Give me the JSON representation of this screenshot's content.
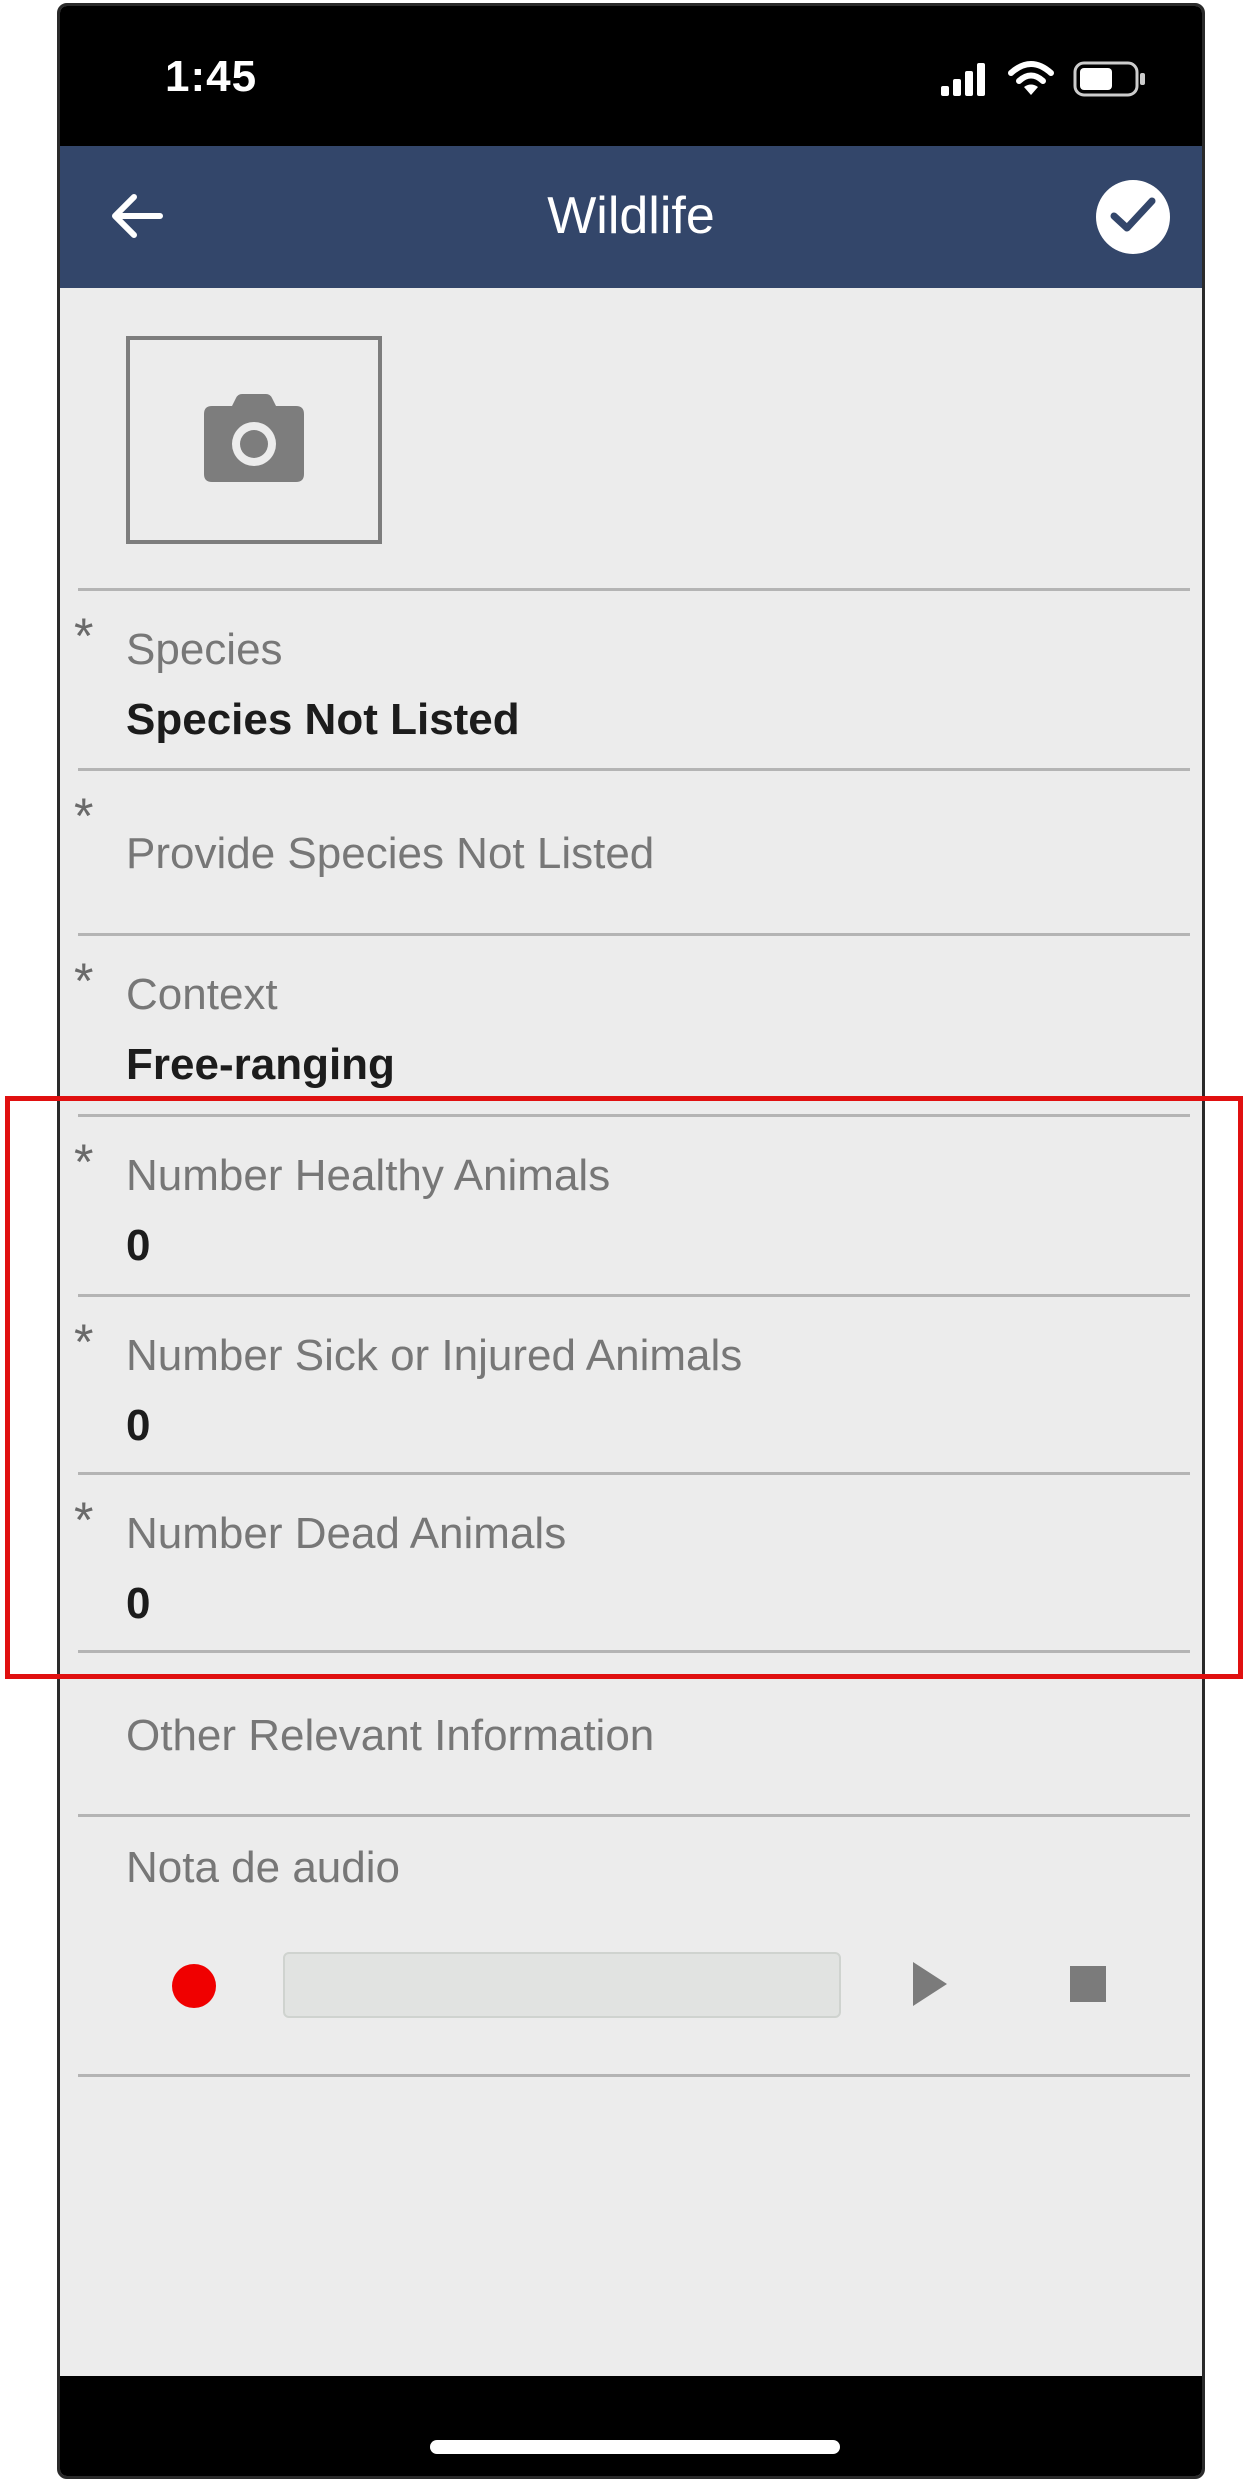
{
  "status_bar": {
    "time": "1:45"
  },
  "app_bar": {
    "title": "Wildlife",
    "back_icon": "arrow-left-icon",
    "confirm_icon": "check-circle-icon",
    "color": "#33466a"
  },
  "photo": {
    "icon": "camera-icon"
  },
  "fields": {
    "species": {
      "required": "*",
      "label": "Species",
      "value": "Species Not Listed"
    },
    "species_not_listed": {
      "required": "*",
      "label": "Provide Species Not Listed"
    },
    "context": {
      "required": "*",
      "label": "Context",
      "value": "Free-ranging"
    },
    "healthy": {
      "required": "*",
      "label": "Number Healthy Animals",
      "value": "0"
    },
    "sick": {
      "required": "*",
      "label": "Number Sick or Injured Animals",
      "value": "0"
    },
    "dead": {
      "required": "*",
      "label": "Number Dead Animals",
      "value": "0"
    },
    "other": {
      "label": "Other Relevant Information"
    }
  },
  "audio": {
    "label": "Nota de audio",
    "record_icon": "record-icon",
    "play_icon": "play-icon",
    "stop_icon": "stop-icon",
    "record_color": "#f00000"
  },
  "highlight_color": "#e01010"
}
